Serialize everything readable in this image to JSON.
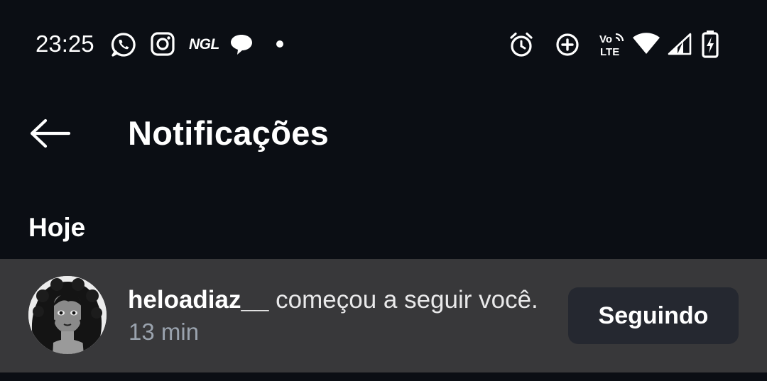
{
  "status_bar": {
    "time": "23:25",
    "left_icons": [
      "whatsapp-icon",
      "instagram-icon",
      "ngl-icon",
      "message-bubble-icon",
      "dot-icon"
    ],
    "ngl_label": "NGL",
    "right_icons": [
      "alarm-icon",
      "data-saver-icon",
      "volte-icon",
      "wifi-icon",
      "signal-icon",
      "battery-charging-icon"
    ],
    "volte_top": "Vo",
    "volte_bottom": "LTE"
  },
  "header": {
    "back_icon": "arrow-left-icon",
    "title": "Notificações"
  },
  "section": {
    "label": "Hoje"
  },
  "notifications": [
    {
      "username": "heloadiaz__",
      "action": " começou a seguir você.",
      "time": "13 min",
      "button_label": "Seguindo"
    }
  ],
  "colors": {
    "background": "#0b0e14",
    "row_highlight": "#38383a",
    "button_bg": "#252830",
    "secondary_text": "#9aa3ae"
  }
}
